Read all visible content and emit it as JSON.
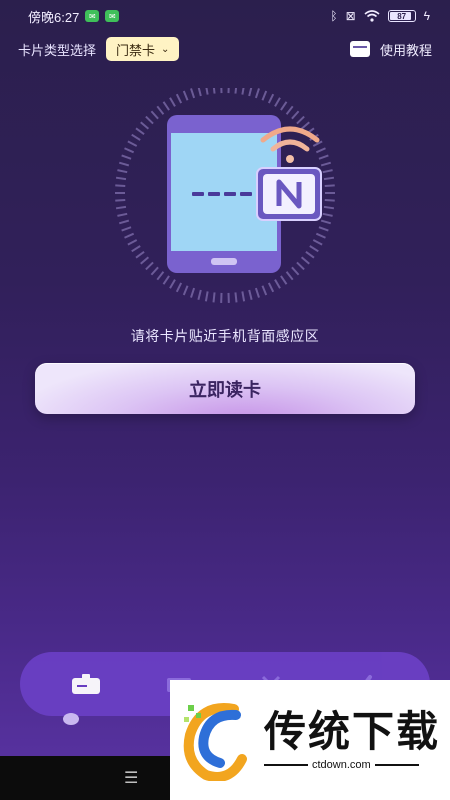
{
  "status": {
    "time": "傍晚6:27",
    "battery": "87",
    "battery_level": 0.87
  },
  "header": {
    "card_type_label": "卡片类型选择",
    "card_type_value": "门禁卡",
    "tutorial_label": "使用教程"
  },
  "main": {
    "hint": "请将卡片贴近手机背面感应区",
    "read_button_label": "立即读卡"
  },
  "bottom_nav": {
    "items": [
      "read-card-icon",
      "card-icon",
      "tools-icon",
      "profile-icon"
    ]
  },
  "watermark": {
    "title": "传统下载",
    "url": "ctdown.com"
  },
  "colors": {
    "background": "#31205a",
    "accent": "#7b5fd6",
    "select_bg": "#fff3c4",
    "button": "#e3d4f6"
  }
}
